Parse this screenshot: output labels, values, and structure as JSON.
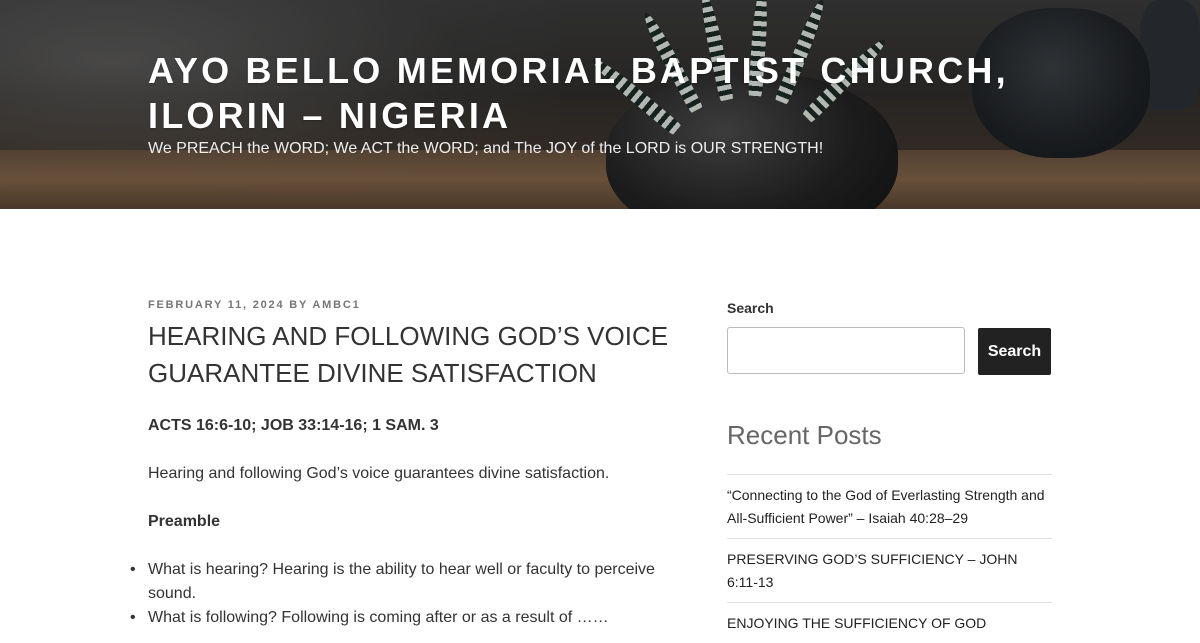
{
  "header": {
    "site_title": "AYO BELLO MEMORIAL BAPTIST CHURCH, ILORIN – NIGERIA",
    "tagline": "We PREACH the WORD; We ACT the WORD; and The JOY of the LORD is OUR STRENGTH!"
  },
  "post": {
    "date": "FEBRUARY 11, 2024",
    "by_label": "BY",
    "author": "AMBC1",
    "title": "HEARING AND FOLLOWING GOD’S VOICE GUARANTEE DIVINE SATISFACTION",
    "scripture": "ACTS 16:6-10; JOB 33:14-16; 1 SAM. 3",
    "intro": "Hearing and following God’s voice guarantees divine satisfaction.",
    "preamble_heading": "Preamble",
    "bullets": [
      "What is hearing? Hearing is the ability to hear well or faculty to perceive sound.",
      "What is following? Following is coming after or as a result of ……"
    ]
  },
  "sidebar": {
    "search_label": "Search",
    "search_value": "",
    "search_placeholder": "",
    "search_button": "Search",
    "recent_posts_title": "Recent Posts",
    "recent_posts": [
      "“Connecting to the God of Everlasting Strength and All-Sufficient Power” – Isaiah 40:28–29",
      "PRESERVING GOD’S SUFFICIENCY – JOHN 6:11-13",
      "ENJOYING THE SUFFICIENCY OF GOD"
    ]
  },
  "colors": {
    "text": "#333333",
    "meta": "#767676",
    "button_bg": "#222222",
    "widget_title": "#666666"
  }
}
